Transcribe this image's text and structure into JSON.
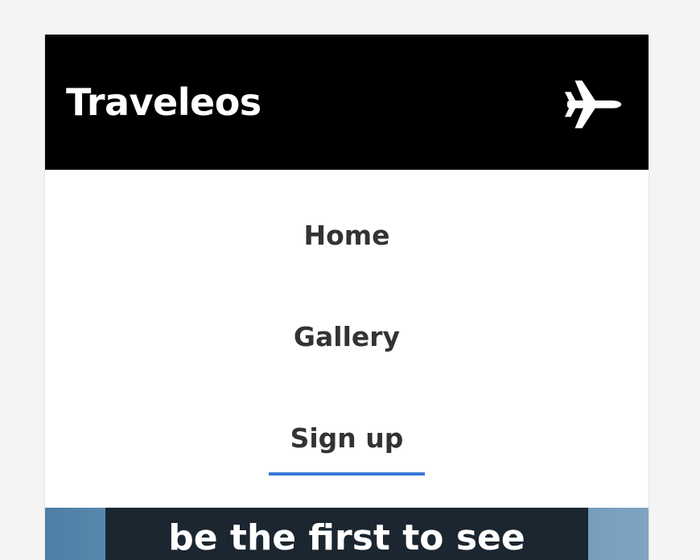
{
  "header": {
    "brand": "Traveleos",
    "icon": "airplane-icon",
    "background_color": "#000000"
  },
  "nav": {
    "items": [
      {
        "label": "Home",
        "active": false
      },
      {
        "label": "Gallery",
        "active": false
      },
      {
        "label": "Sign up",
        "active": true
      }
    ],
    "active_underline_color": "#3a78d8",
    "text_color": "#333333"
  },
  "hero": {
    "headline": "be the first to see"
  }
}
